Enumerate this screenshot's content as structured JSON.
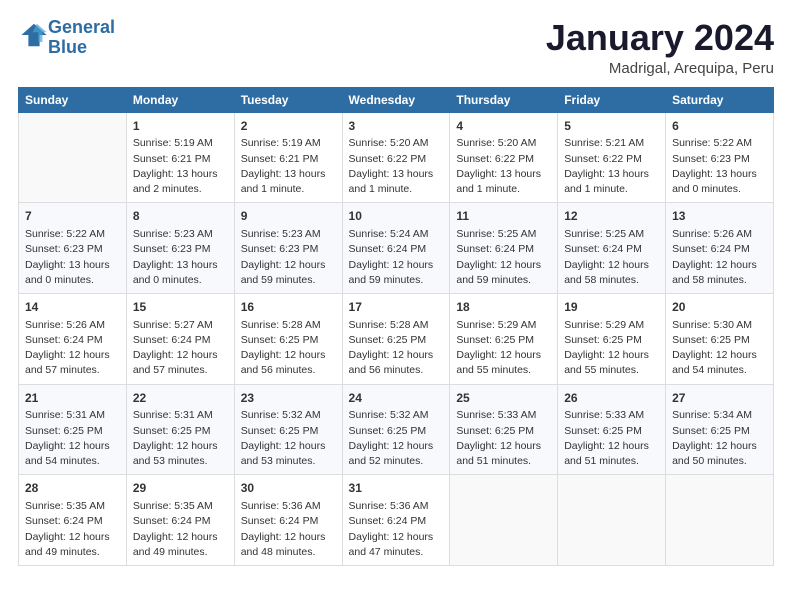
{
  "logo": {
    "line1": "General",
    "line2": "Blue",
    "icon_color": "#2e6da4"
  },
  "title": "January 2024",
  "location": "Madrigal, Arequipa, Peru",
  "days_of_week": [
    "Sunday",
    "Monday",
    "Tuesday",
    "Wednesday",
    "Thursday",
    "Friday",
    "Saturday"
  ],
  "weeks": [
    [
      {
        "num": "",
        "info": ""
      },
      {
        "num": "1",
        "info": "Sunrise: 5:19 AM\nSunset: 6:21 PM\nDaylight: 13 hours\nand 2 minutes."
      },
      {
        "num": "2",
        "info": "Sunrise: 5:19 AM\nSunset: 6:21 PM\nDaylight: 13 hours\nand 1 minute."
      },
      {
        "num": "3",
        "info": "Sunrise: 5:20 AM\nSunset: 6:22 PM\nDaylight: 13 hours\nand 1 minute."
      },
      {
        "num": "4",
        "info": "Sunrise: 5:20 AM\nSunset: 6:22 PM\nDaylight: 13 hours\nand 1 minute."
      },
      {
        "num": "5",
        "info": "Sunrise: 5:21 AM\nSunset: 6:22 PM\nDaylight: 13 hours\nand 1 minute."
      },
      {
        "num": "6",
        "info": "Sunrise: 5:22 AM\nSunset: 6:23 PM\nDaylight: 13 hours\nand 0 minutes."
      }
    ],
    [
      {
        "num": "7",
        "info": "Sunrise: 5:22 AM\nSunset: 6:23 PM\nDaylight: 13 hours\nand 0 minutes."
      },
      {
        "num": "8",
        "info": "Sunrise: 5:23 AM\nSunset: 6:23 PM\nDaylight: 13 hours\nand 0 minutes."
      },
      {
        "num": "9",
        "info": "Sunrise: 5:23 AM\nSunset: 6:23 PM\nDaylight: 12 hours\nand 59 minutes."
      },
      {
        "num": "10",
        "info": "Sunrise: 5:24 AM\nSunset: 6:24 PM\nDaylight: 12 hours\nand 59 minutes."
      },
      {
        "num": "11",
        "info": "Sunrise: 5:25 AM\nSunset: 6:24 PM\nDaylight: 12 hours\nand 59 minutes."
      },
      {
        "num": "12",
        "info": "Sunrise: 5:25 AM\nSunset: 6:24 PM\nDaylight: 12 hours\nand 58 minutes."
      },
      {
        "num": "13",
        "info": "Sunrise: 5:26 AM\nSunset: 6:24 PM\nDaylight: 12 hours\nand 58 minutes."
      }
    ],
    [
      {
        "num": "14",
        "info": "Sunrise: 5:26 AM\nSunset: 6:24 PM\nDaylight: 12 hours\nand 57 minutes."
      },
      {
        "num": "15",
        "info": "Sunrise: 5:27 AM\nSunset: 6:24 PM\nDaylight: 12 hours\nand 57 minutes."
      },
      {
        "num": "16",
        "info": "Sunrise: 5:28 AM\nSunset: 6:25 PM\nDaylight: 12 hours\nand 56 minutes."
      },
      {
        "num": "17",
        "info": "Sunrise: 5:28 AM\nSunset: 6:25 PM\nDaylight: 12 hours\nand 56 minutes."
      },
      {
        "num": "18",
        "info": "Sunrise: 5:29 AM\nSunset: 6:25 PM\nDaylight: 12 hours\nand 55 minutes."
      },
      {
        "num": "19",
        "info": "Sunrise: 5:29 AM\nSunset: 6:25 PM\nDaylight: 12 hours\nand 55 minutes."
      },
      {
        "num": "20",
        "info": "Sunrise: 5:30 AM\nSunset: 6:25 PM\nDaylight: 12 hours\nand 54 minutes."
      }
    ],
    [
      {
        "num": "21",
        "info": "Sunrise: 5:31 AM\nSunset: 6:25 PM\nDaylight: 12 hours\nand 54 minutes."
      },
      {
        "num": "22",
        "info": "Sunrise: 5:31 AM\nSunset: 6:25 PM\nDaylight: 12 hours\nand 53 minutes."
      },
      {
        "num": "23",
        "info": "Sunrise: 5:32 AM\nSunset: 6:25 PM\nDaylight: 12 hours\nand 53 minutes."
      },
      {
        "num": "24",
        "info": "Sunrise: 5:32 AM\nSunset: 6:25 PM\nDaylight: 12 hours\nand 52 minutes."
      },
      {
        "num": "25",
        "info": "Sunrise: 5:33 AM\nSunset: 6:25 PM\nDaylight: 12 hours\nand 51 minutes."
      },
      {
        "num": "26",
        "info": "Sunrise: 5:33 AM\nSunset: 6:25 PM\nDaylight: 12 hours\nand 51 minutes."
      },
      {
        "num": "27",
        "info": "Sunrise: 5:34 AM\nSunset: 6:25 PM\nDaylight: 12 hours\nand 50 minutes."
      }
    ],
    [
      {
        "num": "28",
        "info": "Sunrise: 5:35 AM\nSunset: 6:24 PM\nDaylight: 12 hours\nand 49 minutes."
      },
      {
        "num": "29",
        "info": "Sunrise: 5:35 AM\nSunset: 6:24 PM\nDaylight: 12 hours\nand 49 minutes."
      },
      {
        "num": "30",
        "info": "Sunrise: 5:36 AM\nSunset: 6:24 PM\nDaylight: 12 hours\nand 48 minutes."
      },
      {
        "num": "31",
        "info": "Sunrise: 5:36 AM\nSunset: 6:24 PM\nDaylight: 12 hours\nand 47 minutes."
      },
      {
        "num": "",
        "info": ""
      },
      {
        "num": "",
        "info": ""
      },
      {
        "num": "",
        "info": ""
      }
    ]
  ]
}
